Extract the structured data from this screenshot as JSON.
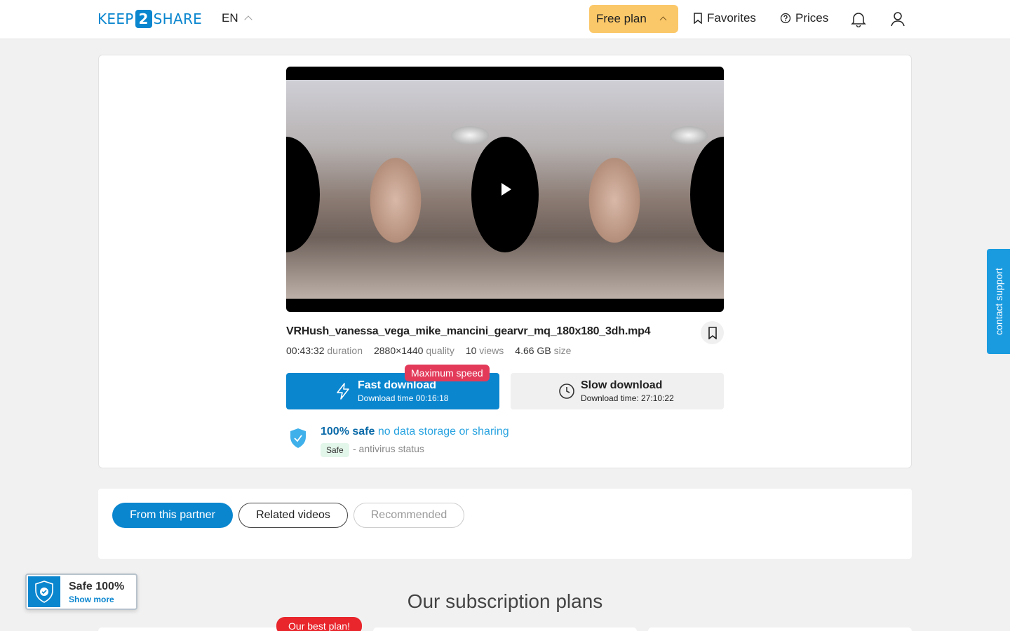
{
  "header": {
    "logo_left": "KEEP",
    "logo_mid": "2",
    "logo_right": "SHARE",
    "language": "EN",
    "plan_label": "Free plan",
    "favorites_label": "Favorites",
    "prices_label": "Prices",
    "icons": [
      "chevron-up-icon",
      "bookmark-icon",
      "help-circle-icon",
      "bell-icon",
      "user-icon"
    ]
  },
  "file": {
    "name": "VRHush_vanessa_vega_mike_mancini_gearvr_mq_180x180_3dh.mp4",
    "duration_value": "00:43:32",
    "duration_label": "duration",
    "quality_value": "2880×1440",
    "quality_label": "quality",
    "views_value": "10",
    "views_label": "views",
    "size_value": "4.66 GB",
    "size_label": "size"
  },
  "download": {
    "max_speed_badge": "Maximum speed",
    "fast_title": "Fast download",
    "fast_subtitle": "Download time 00:16:18",
    "slow_title": "Slow download",
    "slow_subtitle": "Download time: 27:10:22"
  },
  "safety": {
    "title_bold": "100% safe",
    "title_rest": "no data storage or sharing",
    "badge": "Safe",
    "status": "- antivirus status"
  },
  "tabs": [
    "From this partner",
    "Related videos",
    "Recommended"
  ],
  "plans": {
    "title": "Our subscription plans",
    "best_plan_badge": "Our best plan!"
  },
  "safe_widget": {
    "title": "Safe 100%",
    "link": "Show more"
  },
  "contact_support": "contact support",
  "colors": {
    "primary": "#0a86cf",
    "plan_yellow": "#fbc869",
    "badge_red": "#e33a5a",
    "best_plan_red": "#e8262c"
  }
}
